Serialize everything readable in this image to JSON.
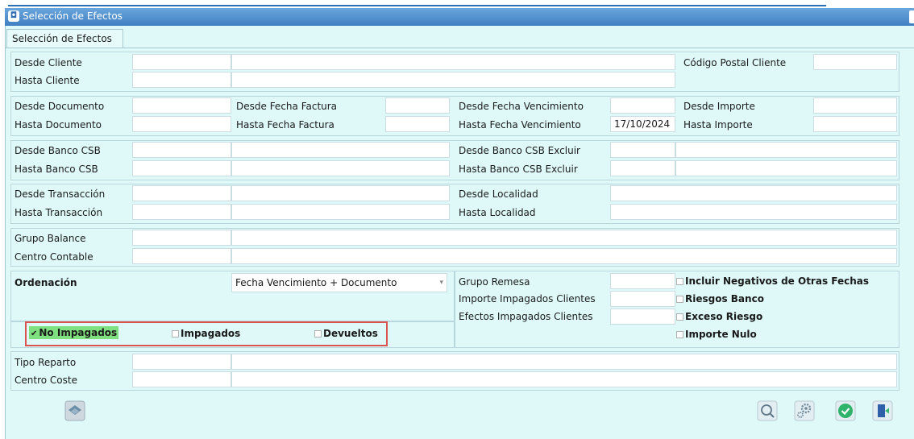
{
  "window": {
    "title": "Selección de Efectos"
  },
  "tabs": [
    {
      "label": "Selección de Efectos"
    }
  ],
  "cliente": {
    "desde_label": "Desde Cliente",
    "hasta_label": "Hasta Cliente",
    "cp_label": "Código Postal Cliente"
  },
  "documento": {
    "desde_doc_label": "Desde Documento",
    "hasta_doc_label": "Hasta Documento",
    "desde_ff_label": "Desde Fecha Factura",
    "hasta_ff_label": "Hasta Fecha Factura",
    "desde_fv_label": "Desde Fecha Vencimiento",
    "hasta_fv_label": "Hasta Fecha Vencimiento",
    "hasta_fv_value": "17/10/2024",
    "desde_imp_label": "Desde Importe",
    "hasta_imp_label": "Hasta Importe"
  },
  "banco": {
    "desde_label": "Desde Banco CSB",
    "hasta_label": "Hasta Banco CSB",
    "desde_excl_label": "Desde Banco CSB Excluir",
    "hasta_excl_label": "Hasta Banco CSB Excluir"
  },
  "transaccion": {
    "desde_label": "Desde Transacción",
    "hasta_label": "Hasta Transacción",
    "desde_loc_label": "Desde Localidad",
    "hasta_loc_label": "Hasta Localidad"
  },
  "balance": {
    "grupo_label": "Grupo Balance",
    "centro_label": "Centro Contable"
  },
  "ordenacion": {
    "label": "Ordenación",
    "selected": "Fecha Vencimiento + Documento",
    "grupo_remesa_label": "Grupo Remesa",
    "importe_impagados_label": "Importe Impagados Clientes",
    "efectos_impagados_label": "Efectos Impagados Clientes"
  },
  "checks": {
    "no_impagados": "No Impagados",
    "impagados": "Impagados",
    "devueltos": "Devueltos",
    "incluir_negativos": "Incluir Negativos de Otras Fechas",
    "riesgos_banco": "Riesgos Banco",
    "exceso_riesgo": "Exceso Riesgo",
    "importe_nulo": "Importe Nulo"
  },
  "reparto": {
    "tipo_label": "Tipo Reparto",
    "centro_coste_label": "Centro Coste"
  },
  "icons": {
    "layers": "layers-icon",
    "search": "search-icon",
    "settings": "gears-icon",
    "accept": "check-circle-icon",
    "exit": "exit-door-icon"
  },
  "colors": {
    "background": "#dff9f9",
    "title": "#3f7fc2",
    "accept": "#2fb36b",
    "highlight": "#7fe07f",
    "outline": "#d9534f"
  }
}
